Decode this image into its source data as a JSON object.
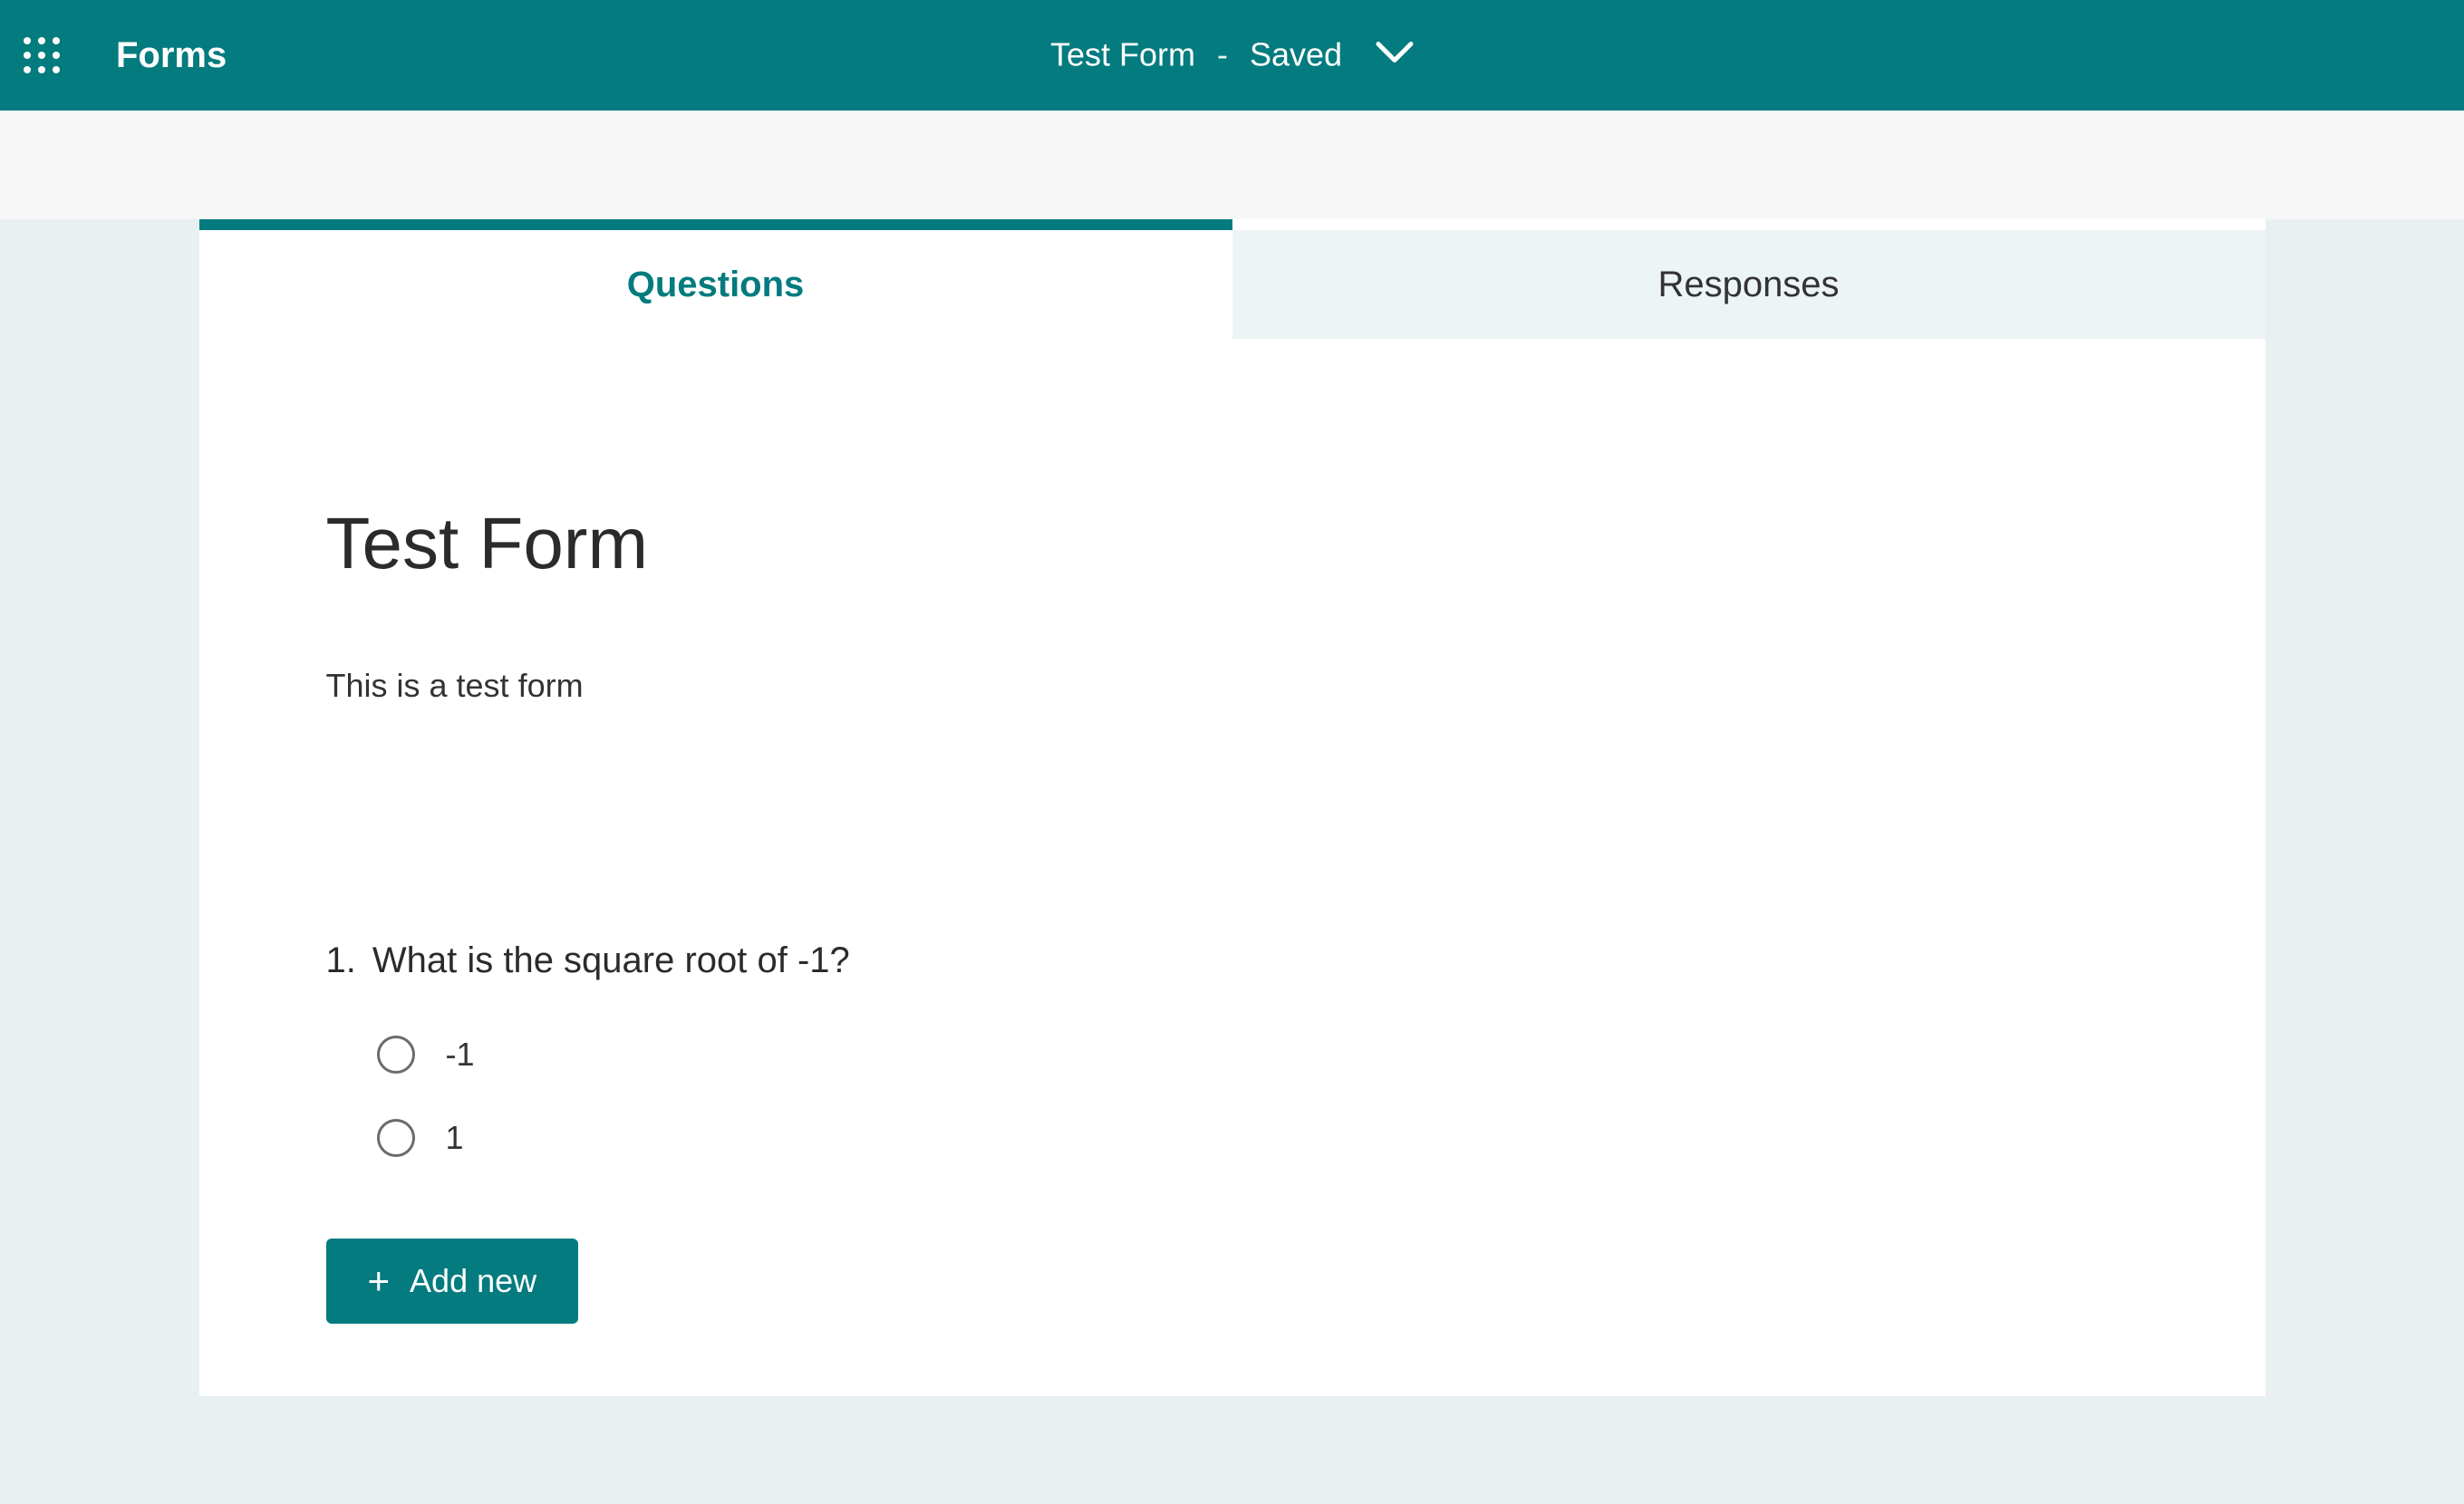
{
  "header": {
    "app_name": "Forms",
    "form_name": "Test Form",
    "separator": "-",
    "save_status": "Saved"
  },
  "tabs": {
    "questions": "Questions",
    "responses": "Responses"
  },
  "form": {
    "title": "Test Form",
    "description": "This is a test form"
  },
  "questions": [
    {
      "number": "1.",
      "text": "What is the square root of -1?",
      "options": [
        "-1",
        "1"
      ]
    }
  ],
  "buttons": {
    "add_new": "Add new"
  }
}
